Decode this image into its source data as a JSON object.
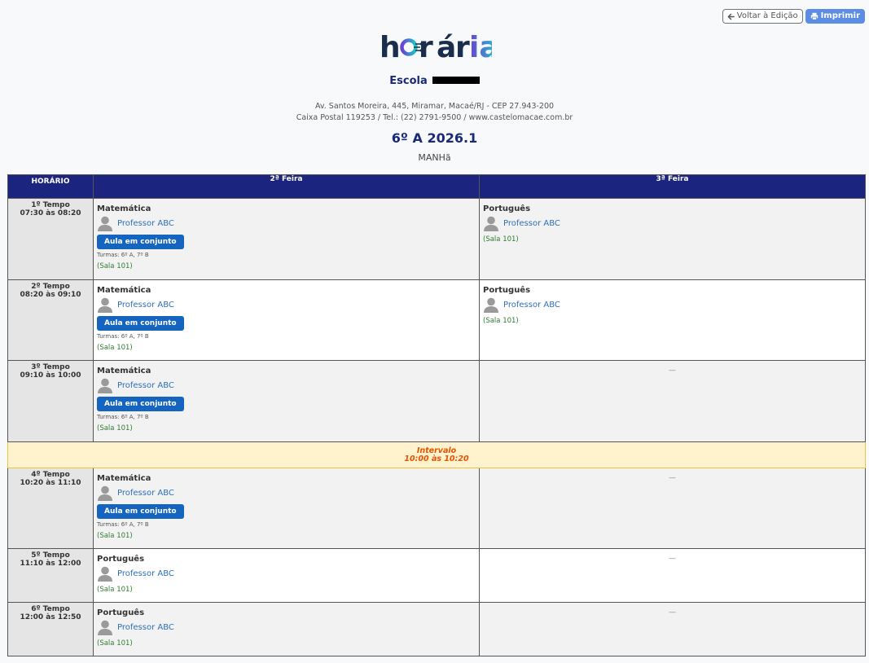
{
  "toolbar": {
    "back_label": "Voltar à Edição",
    "print_label": "Imprimir"
  },
  "brand": {
    "logo_text_dark": "h r",
    "logo_text_accent_o": "o",
    "logo_text_rest": "ária",
    "colors": {
      "dark": "#1a2d4c",
      "accent_start": "#6a3fd6",
      "accent_end": "#1ec8c8"
    }
  },
  "school": {
    "name": "Escola",
    "address_line1": "Av. Santos Moreira, 445, Miramar, Macaé/RJ - CEP 27.943-200",
    "address_line2": "Caixa Postal 119253 / Tel.: (22) 2791-9500 / www.castelomacae.com.br"
  },
  "schedule": {
    "title": "6º A 2026.1",
    "shift": "MANHã",
    "headers": {
      "time": "HORÁRIO",
      "day1": "2ª Feira",
      "day2": "3ª Feira"
    },
    "empty_mark": "—",
    "interval": {
      "label": "Intervalo",
      "time": "10:00 às 10:20"
    },
    "rows": [
      {
        "period": "1º Tempo",
        "time": "07:30 às 08:20",
        "day1": {
          "subject": "Matemática",
          "teacher": "Professor ABC",
          "joint_label": "Aula em conjunto",
          "classes": "Turmas: 6º A, 7º B",
          "room": "(Sala 101)"
        },
        "day2": {
          "subject": "Português",
          "teacher": "Professor ABC",
          "room": "(Sala 101)"
        }
      },
      {
        "period": "2º Tempo",
        "time": "08:20 às 09:10",
        "day1": {
          "subject": "Matemática",
          "teacher": "Professor ABC",
          "joint_label": "Aula em conjunto",
          "classes": "Turmas: 6º A, 7º B",
          "room": "(Sala 101)"
        },
        "day2": {
          "subject": "Português",
          "teacher": "Professor ABC",
          "room": "(Sala 101)"
        }
      },
      {
        "period": "3º Tempo",
        "time": "09:10 às 10:00",
        "day1": {
          "subject": "Matemática",
          "teacher": "Professor ABC",
          "joint_label": "Aula em conjunto",
          "classes": "Turmas: 6º A, 7º B",
          "room": "(Sala 101)"
        }
      },
      {
        "period": "4º Tempo",
        "time": "10:20 às 11:10",
        "day1": {
          "subject": "Matemática",
          "teacher": "Professor ABC",
          "joint_label": "Aula em conjunto",
          "classes": "Turmas: 6º A, 7º B",
          "room": "(Sala 101)"
        }
      },
      {
        "period": "5º Tempo",
        "time": "11:10 às 12:00",
        "day1": {
          "subject": "Português",
          "teacher": "Professor ABC",
          "room": "(Sala 101)"
        }
      },
      {
        "period": "6º Tempo",
        "time": "12:00 às 12:50",
        "day1": {
          "subject": "Português",
          "teacher": "Professor ABC",
          "room": "(Sala 101)"
        }
      }
    ]
  }
}
